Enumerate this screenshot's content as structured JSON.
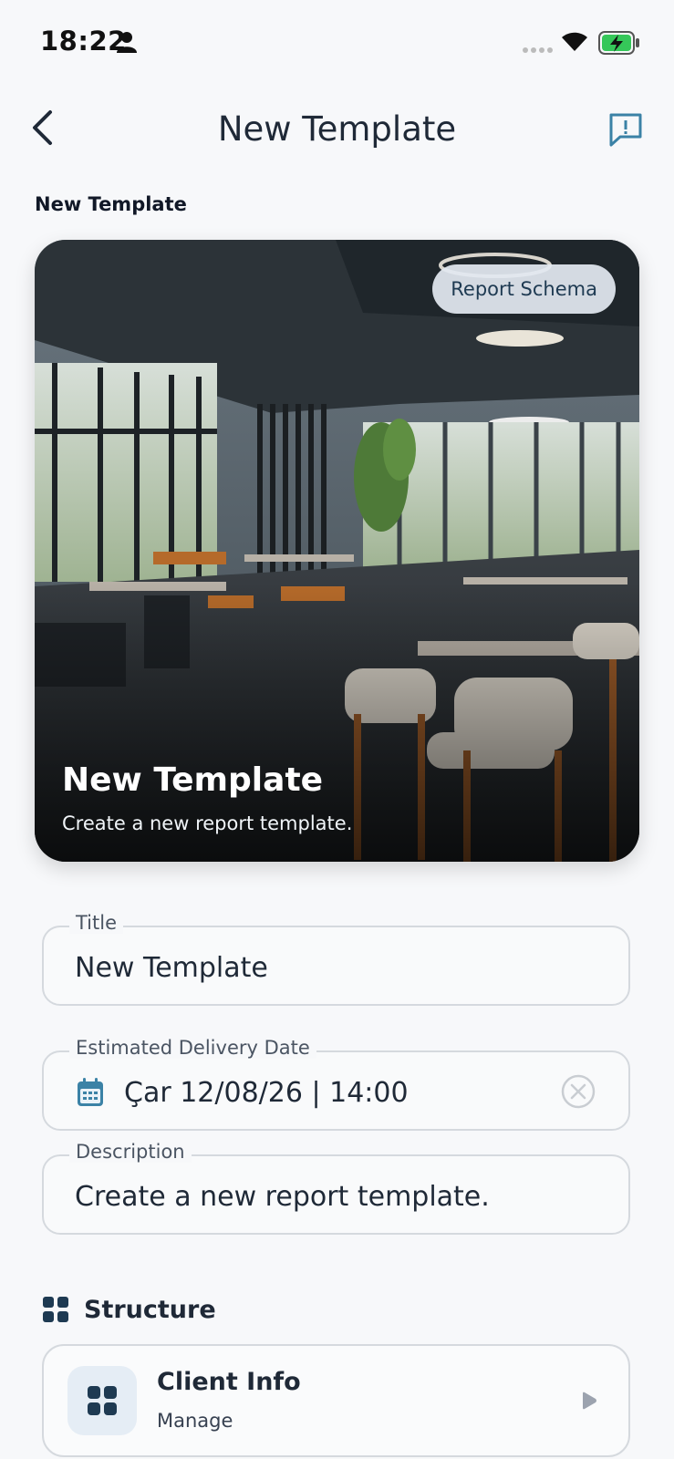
{
  "status_bar": {
    "time": "18:22"
  },
  "header": {
    "title": "New Template"
  },
  "section_label": "New Template",
  "hero": {
    "badge": "Report Schema",
    "title": "New Template",
    "subtitle": "Create a new report template."
  },
  "form": {
    "title_field": {
      "label": "Title",
      "value": "New Template"
    },
    "date_field": {
      "label": "Estimated Delivery Date",
      "value": "Çar 12/08/26 | 14:00"
    },
    "description_field": {
      "label": "Description",
      "value": "Create a new report template."
    }
  },
  "structure": {
    "heading": "Structure",
    "items": [
      {
        "name": "Client Info",
        "action": "Manage"
      }
    ]
  },
  "colors": {
    "accent": "#3b82a6",
    "dark_icon": "#1e3a52",
    "background": "#f7f8fa"
  }
}
